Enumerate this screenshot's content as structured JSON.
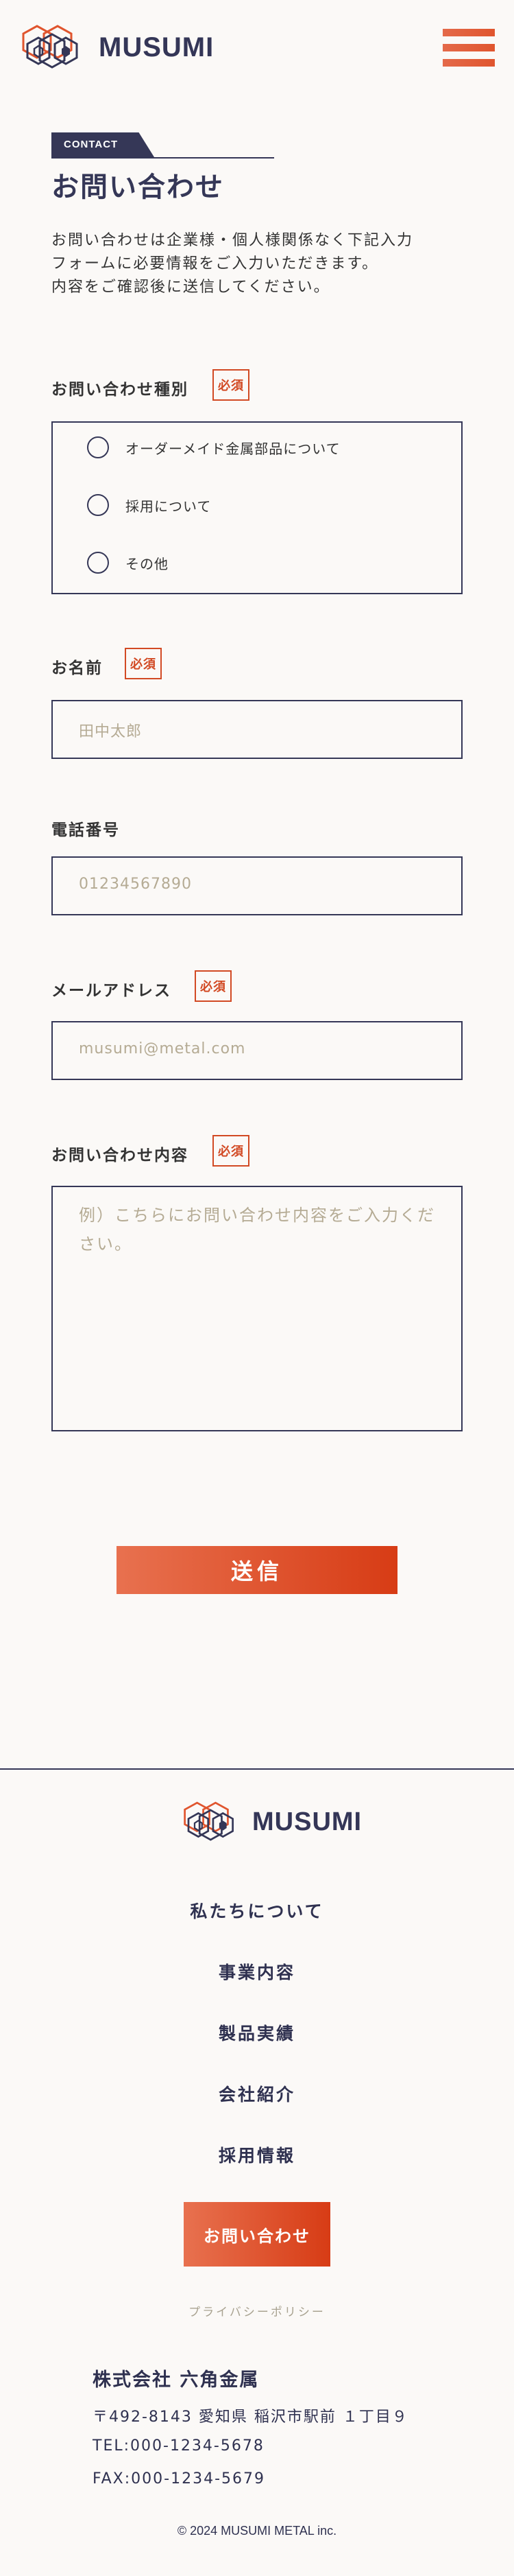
{
  "header": {
    "brand": "MUSUMI",
    "colors": {
      "accent": "#e0552e",
      "navy": "#353757",
      "background": "#fbf9f7"
    }
  },
  "contact": {
    "tag": "CONTACT",
    "title": "お問い合わせ",
    "intro": [
      "お問い合わせは企業様・個人様関係なく下記入力",
      "フォームに必要情報をご入力いただきます。",
      "内容をご確認後に送信してください。"
    ]
  },
  "form": {
    "required_label": "必須",
    "type_label": "お問い合わせ種別",
    "type_options": [
      "オーダーメイド金属部品について",
      "採用について",
      "その他"
    ],
    "name_label": "お名前",
    "name_placeholder": "田中太郎",
    "phone_label": "電話番号",
    "phone_placeholder": "01234567890",
    "email_label": "メールアドレス",
    "email_placeholder": "musumi@metal.com",
    "message_label": "お問い合わせ内容",
    "message_placeholder": "例）こちらにお問い合わせ内容をご入力ください。",
    "submit_label": "送信"
  },
  "footer": {
    "brand": "MUSUMI",
    "nav": [
      "私たちについて",
      "事業内容",
      "製品実績",
      "会社紹介",
      "採用情報"
    ],
    "contact_button": "お問い合わせ",
    "privacy": "プライバシーポリシー",
    "company": "株式会社 六角金属",
    "address": "〒492-8143 愛知県 稲沢市駅前 １丁目９",
    "tel": "TEL:000-1234-5678",
    "fax": "FAX:000-1234-5679",
    "copyright": "© 2024 MUSUMI METAL inc."
  }
}
